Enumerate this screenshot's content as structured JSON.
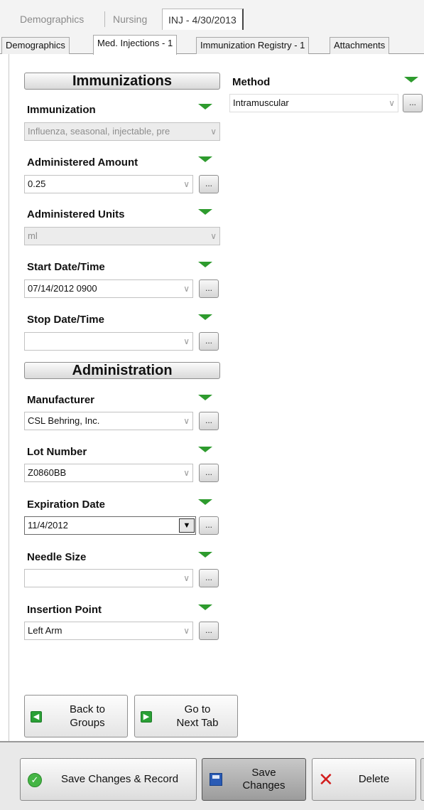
{
  "top_tabs": [
    {
      "label": "Demographics"
    },
    {
      "label": "Nursing"
    },
    {
      "label": "INJ - 4/30/2013"
    }
  ],
  "sub_tabs": [
    {
      "label": "Demographics"
    },
    {
      "label": "Med. Injections - 1"
    },
    {
      "label": "Immunization Registry - 1"
    },
    {
      "label": "Attachments"
    }
  ],
  "immunizations": {
    "header": "Immunizations",
    "immunization": {
      "label": "Immunization",
      "value": "Influenza, seasonal, injectable, pre"
    },
    "administered_amount": {
      "label": "Administered Amount",
      "value": "0.25"
    },
    "administered_units": {
      "label": "Administered Units",
      "value": "ml"
    },
    "start_datetime": {
      "label": "Start Date/Time",
      "value": "07/14/2012 0900"
    },
    "stop_datetime": {
      "label": "Stop Date/Time",
      "value": ""
    }
  },
  "method": {
    "label": "Method",
    "value": "Intramuscular"
  },
  "administration": {
    "header": "Administration",
    "manufacturer": {
      "label": "Manufacturer",
      "value": "CSL Behring, Inc."
    },
    "lot_number": {
      "label": "Lot Number",
      "value": "Z0860BB"
    },
    "expiration_date": {
      "label": "Expiration Date",
      "value": "11/4/2012"
    },
    "needle_size": {
      "label": "Needle Size",
      "value": ""
    },
    "insertion_point": {
      "label": "Insertion Point",
      "value": "Left Arm"
    }
  },
  "ellipsis": "...",
  "chevron": "∨",
  "dropdown_arrow": "▼",
  "nav": {
    "back_line1": "Back to",
    "back_line2": "Groups",
    "next_line1": "Go to",
    "next_line2": "Next Tab"
  },
  "actions": {
    "save_record": "Save Changes & Record",
    "save_line1": "Save",
    "save_line2": "Changes",
    "delete": "Delete"
  },
  "icons": {
    "indicator": "green-triangle-icon",
    "back": "green-arrow-left-icon",
    "next": "green-arrow-right-icon",
    "save_record": "green-check-icon",
    "save": "floppy-disk-icon",
    "delete": "red-x-icon"
  },
  "colors": {
    "indicator_green": "#2e9b2e",
    "delete_red": "#d21d1d"
  }
}
